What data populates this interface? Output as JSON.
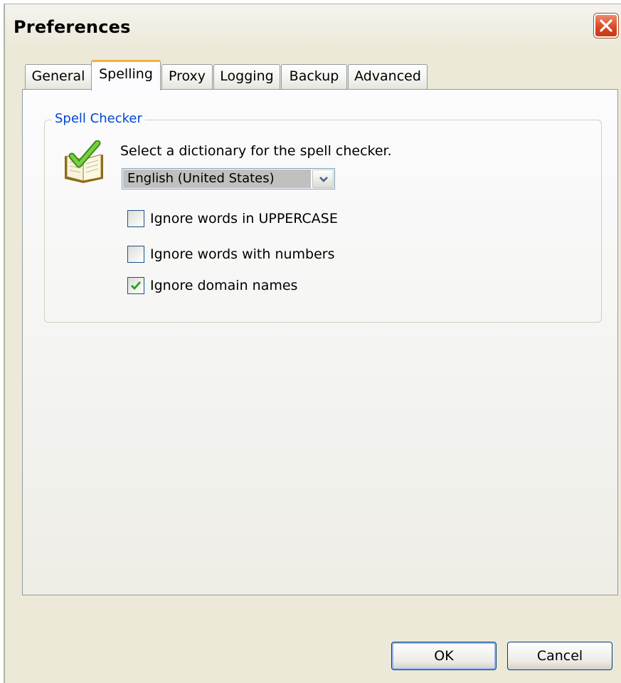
{
  "window": {
    "title": "Preferences"
  },
  "tabs": [
    {
      "label": "General"
    },
    {
      "label": "Spelling"
    },
    {
      "label": "Proxy"
    },
    {
      "label": "Logging"
    },
    {
      "label": "Backup"
    },
    {
      "label": "Advanced"
    }
  ],
  "active_tab": "Spelling",
  "spell_checker": {
    "group_title": "Spell Checker",
    "dictionary_label": "Select a dictionary for the spell checker.",
    "dictionary_value": "English (United States)",
    "options": [
      {
        "label": "Ignore words in UPPERCASE",
        "checked": false
      },
      {
        "label": "Ignore words with numbers",
        "checked": false
      },
      {
        "label": "Ignore domain names",
        "checked": true
      }
    ]
  },
  "buttons": {
    "ok": "OK",
    "cancel": "Cancel"
  },
  "colors": {
    "window_bg": "#ece9d8",
    "accent_tab": "#f5b03c",
    "group_title": "#0046d5",
    "close_button": "#d8461f",
    "checkmark": "#21a121"
  },
  "icons": {
    "close": "close-icon",
    "dictionary": "dictionary-book-icon",
    "dropdown": "chevron-down-icon",
    "check": "checkmark-icon"
  }
}
